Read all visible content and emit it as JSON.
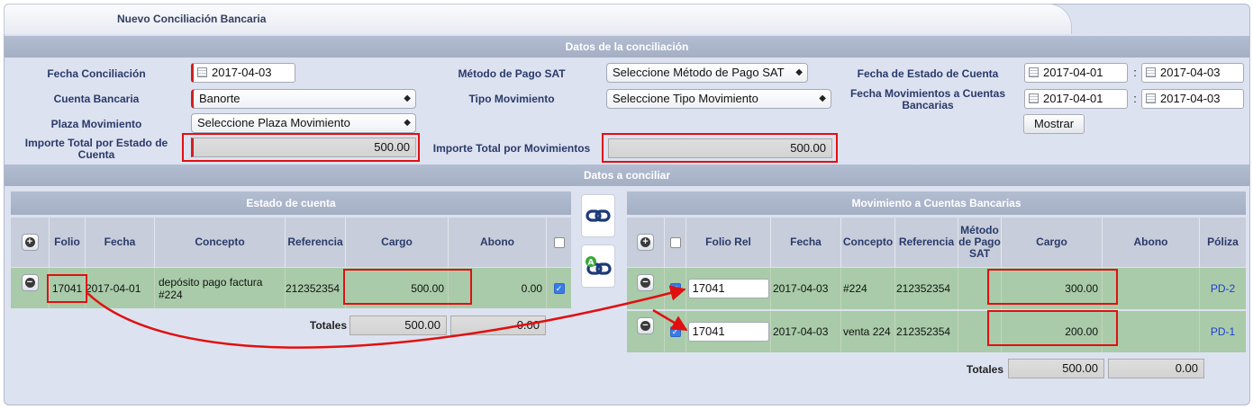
{
  "window": {
    "title": "Nuevo Conciliación Bancaria"
  },
  "sections": {
    "datos_conciliacion": "Datos de la conciliación",
    "datos_conciliar": "Datos a conciliar"
  },
  "form": {
    "fecha_conciliacion": {
      "label": "Fecha Conciliación",
      "value": "2017-04-03"
    },
    "cuenta_bancaria": {
      "label": "Cuenta Bancaria",
      "value": "Banorte"
    },
    "plaza_movimiento": {
      "label": "Plaza Movimiento",
      "value": "Seleccione Plaza Movimiento"
    },
    "importe_estado": {
      "label": "Importe Total por Estado de Cuenta",
      "value": "500.00"
    },
    "metodo_pago": {
      "label": "Método de Pago SAT",
      "value": "Seleccione Método de Pago SAT"
    },
    "tipo_movimiento": {
      "label": "Tipo Movimiento",
      "value": "Seleccione Tipo Movimiento"
    },
    "importe_movimientos": {
      "label": "Importe Total por Movimientos",
      "value": "500.00"
    },
    "fecha_estado": {
      "label": "Fecha de Estado de Cuenta",
      "from": "2017-04-01",
      "to": "2017-04-03"
    },
    "fecha_movimientos": {
      "label": "Fecha Movimientos a Cuentas Bancarias",
      "from": "2017-04-01",
      "to": "2017-04-03"
    },
    "separator": ":",
    "mostrar_label": "Mostrar"
  },
  "estado": {
    "title": "Estado de cuenta",
    "headers": {
      "folio": "Folio",
      "fecha": "Fecha",
      "concepto": "Concepto",
      "referencia": "Referencia",
      "cargo": "Cargo",
      "abono": "Abono"
    },
    "rows": [
      {
        "folio": "17041",
        "fecha": "2017-04-01",
        "concepto": "depósito pago factura #224",
        "referencia": "212352354",
        "cargo": "500.00",
        "abono": "0.00"
      }
    ],
    "totales_label": "Totales",
    "total_cargo": "500.00",
    "total_abono": "0.00"
  },
  "movimientos": {
    "title": "Movimiento a Cuentas Bancarias",
    "headers": {
      "folio_rel": "Folio Rel",
      "fecha": "Fecha",
      "concepto": "Concepto",
      "referencia": "Referencia",
      "metodo": "Método de Pago SAT",
      "cargo": "Cargo",
      "abono": "Abono",
      "poliza": "Póliza"
    },
    "rows": [
      {
        "folio_rel": "17041",
        "fecha": "2017-04-03",
        "concepto": "#224",
        "referencia": "212352354",
        "cargo": "300.00",
        "abono": "",
        "poliza": "PD-2"
      },
      {
        "folio_rel": "17041",
        "fecha": "2017-04-03",
        "concepto": "venta 224",
        "referencia": "212352354",
        "cargo": "200.00",
        "abono": "",
        "poliza": "PD-1"
      }
    ],
    "totales_label": "Totales",
    "total_cargo": "500.00",
    "total_abono": "0.00"
  },
  "icons": {
    "link": "chain-link-icon",
    "auto_link": "auto-link-icon",
    "add": "plus-circle-icon",
    "remove": "minus-circle-icon",
    "calendar": "calendar-icon"
  },
  "colors": {
    "annotation": "#e01010",
    "row_green": "#a9cba9",
    "section_header": "#a9b3c8",
    "link_blue": "#1f3ed6"
  }
}
